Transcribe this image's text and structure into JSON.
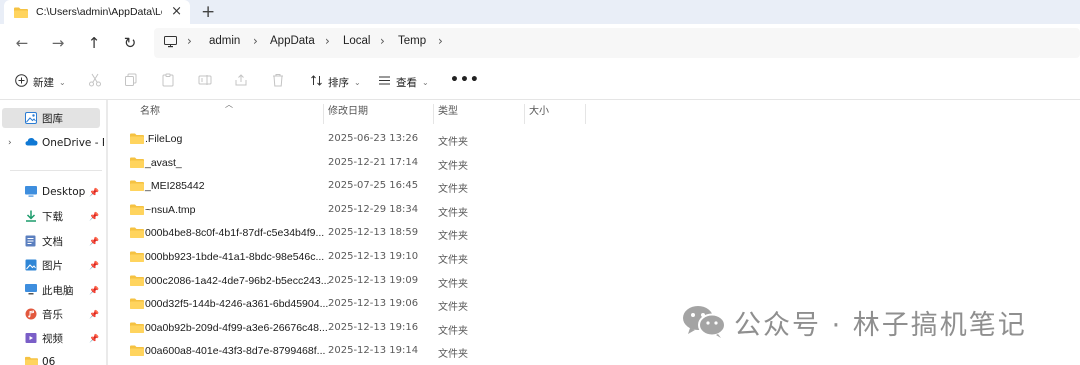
{
  "tab": {
    "title": "C:\\Users\\admin\\AppData\\Loca",
    "close": "×",
    "add": "+"
  },
  "nav": {
    "back": "←",
    "forward": "→",
    "up": "↑",
    "refresh": "↻",
    "breadcrumb": [
      "admin",
      "AppData",
      "Local",
      "Temp"
    ],
    "sep": "›"
  },
  "toolbar": {
    "new_label": "新建",
    "sort_label": "排序",
    "view_label": "查看",
    "more": "•••"
  },
  "sidebar": {
    "items": [
      {
        "label": "图库",
        "icon": "gallery-icon"
      },
      {
        "label": "OneDrive - Pe",
        "icon": "onedrive-icon"
      },
      {
        "label": "Desktop",
        "icon": "desktop-icon"
      },
      {
        "label": "下载",
        "icon": "download-icon"
      },
      {
        "label": "文档",
        "icon": "document-icon"
      },
      {
        "label": "图片",
        "icon": "picture-icon"
      },
      {
        "label": "此电脑",
        "icon": "computer-icon"
      },
      {
        "label": "音乐",
        "icon": "music-icon"
      },
      {
        "label": "视频",
        "icon": "video-icon"
      },
      {
        "label": "06",
        "icon": "folder-icon"
      }
    ]
  },
  "columns": {
    "name": "名称",
    "date": "修改日期",
    "type": "类型",
    "size": "大小"
  },
  "files": [
    {
      "name": ".FileLog",
      "date": "2025-06-23 13:26",
      "type": "文件夹"
    },
    {
      "name": "_avast_",
      "date": "2025-12-21 17:14",
      "type": "文件夹"
    },
    {
      "name": "_MEI285442",
      "date": "2025-07-25 16:45",
      "type": "文件夹"
    },
    {
      "name": "~nsuA.tmp",
      "date": "2025-12-29 18:34",
      "type": "文件夹"
    },
    {
      "name": "000b4be8-8c0f-4b1f-87df-c5e34b4f9...",
      "date": "2025-12-13 18:59",
      "type": "文件夹"
    },
    {
      "name": "000bb923-1bde-41a1-8bdc-98e546c...",
      "date": "2025-12-13 19:10",
      "type": "文件夹"
    },
    {
      "name": "000c2086-1a42-4de7-96b2-b5ecc243...",
      "date": "2025-12-13 19:09",
      "type": "文件夹"
    },
    {
      "name": "000d32f5-144b-4246-a361-6bd45904...",
      "date": "2025-12-13 19:06",
      "type": "文件夹"
    },
    {
      "name": "00a0b92b-209d-4f99-a3e6-26676c48...",
      "date": "2025-12-13 19:16",
      "type": "文件夹"
    },
    {
      "name": "00a600a8-401e-43f3-8d7e-8799468f...",
      "date": "2025-12-13 19:14",
      "type": "文件夹"
    }
  ],
  "watermark": {
    "text": "公众号 · 林子搞机笔记"
  },
  "colors": {
    "folder": "#f5c242",
    "accent": "#0067c0",
    "selected_bg": "#e3e3e3",
    "tabbar_bg": "#e9eef7"
  }
}
